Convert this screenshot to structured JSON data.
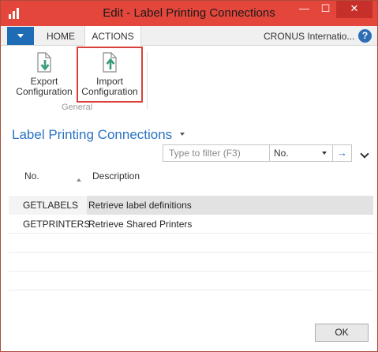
{
  "window": {
    "title": "Edit - Label Printing Connections",
    "minimize_glyph": "—",
    "maximize_glyph": "☐",
    "close_glyph": "✕"
  },
  "ribbon": {
    "tabs": [
      {
        "label": "HOME"
      },
      {
        "label": "ACTIONS"
      }
    ],
    "company": "CRONUS Internatio...",
    "help_glyph": "?",
    "buttons": [
      {
        "label_line1": "Export",
        "label_line2": "Configuration",
        "icon": "export-icon"
      },
      {
        "label_line1": "Import",
        "label_line2": "Configuration",
        "icon": "import-icon"
      }
    ],
    "group_label": "General"
  },
  "page": {
    "title": "Label Printing Connections"
  },
  "filter": {
    "placeholder": "Type to filter (F3)",
    "field": "No.",
    "go_glyph": "→"
  },
  "list": {
    "columns": [
      "No.",
      "Description"
    ],
    "rows": [
      {
        "no": "GETLABELS",
        "description": "Retrieve label definitions"
      },
      {
        "no": "GETPRINTERS",
        "description": "Retrieve Shared Printers"
      }
    ]
  },
  "footer": {
    "ok_label": "OK"
  },
  "colors": {
    "titlebar": "#e4463b",
    "accent_blue": "#1f6cb6",
    "highlight_border": "#d9413a",
    "page_title": "#2b73c3"
  }
}
